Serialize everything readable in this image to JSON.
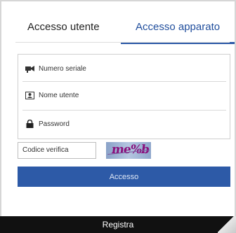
{
  "tabs": {
    "user_label": "Accesso utente",
    "device_label": "Accesso apparato",
    "active": "device"
  },
  "form": {
    "serial_placeholder": "Numero seriale",
    "username_placeholder": "Nome utente",
    "password_placeholder": "Password",
    "captcha_placeholder": "Codice verifica",
    "captcha_text": "me%b"
  },
  "buttons": {
    "login_label": "Accesso",
    "register_label": "Registra"
  },
  "colors": {
    "accent": "#2d5aa7",
    "bottom_bar": "#111111"
  },
  "icons": {
    "serial": "camera-icon",
    "username": "id-card-icon",
    "password": "lock-icon"
  }
}
